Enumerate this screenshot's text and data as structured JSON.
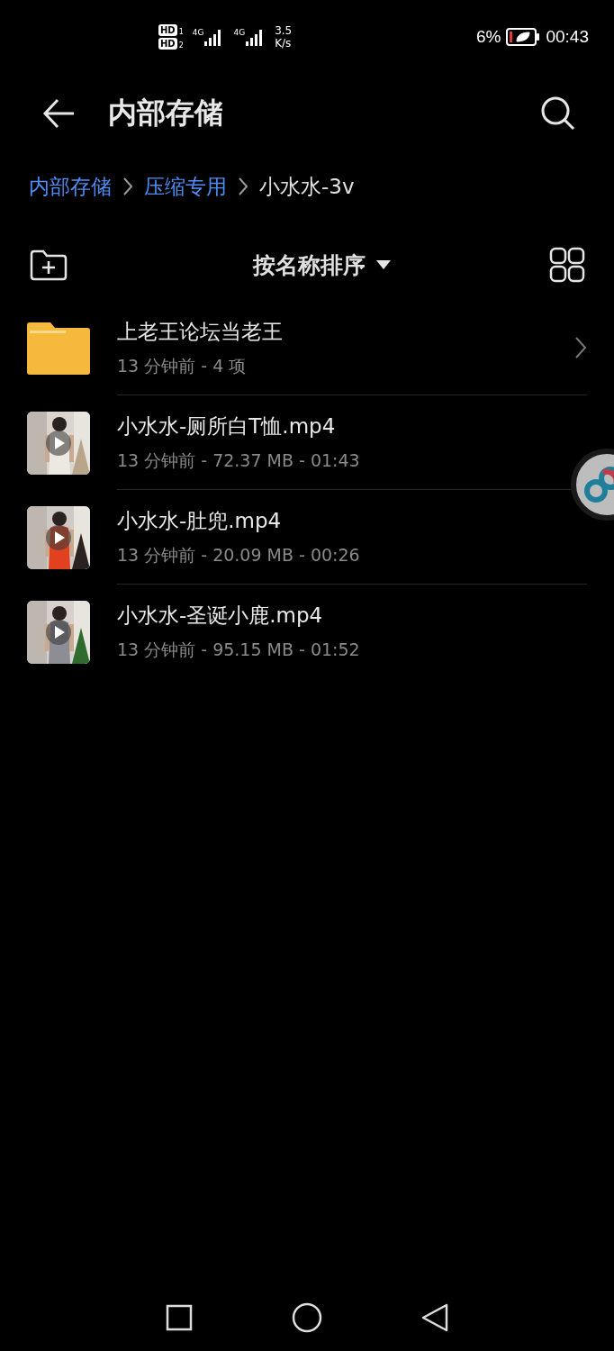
{
  "status_bar": {
    "sim_1": {
      "label": "HD",
      "slot": "1",
      "network": "4G"
    },
    "sim_2": {
      "label": "HD",
      "slot": "2",
      "network": "4G"
    },
    "speed_value": "3.5",
    "speed_unit": "K/s",
    "battery": "6%",
    "time": "00:43"
  },
  "header": {
    "title": "内部存储"
  },
  "breadcrumbs": [
    {
      "label": "内部存储",
      "selected": false
    },
    {
      "label": "压缩专用",
      "selected": false
    },
    {
      "label": "小水水-3v",
      "selected": true
    }
  ],
  "toolbar": {
    "sort": "按名称排序"
  },
  "files": [
    {
      "kind": "folder",
      "name": "上老王论坛当老王",
      "details": "13 分钟前 - 4 项"
    },
    {
      "kind": "video",
      "name": "小水水-厕所白T恤.mp4",
      "details": "13 分钟前 - 72.37 MB - 01:43"
    },
    {
      "kind": "video",
      "name": "小水水-肚兜.mp4",
      "details": "13 分钟前 - 20.09 MB - 00:26"
    },
    {
      "kind": "video",
      "name": "小水水-圣诞小鹿.mp4",
      "details": "13 分钟前 - 95.15 MB - 01:52"
    }
  ]
}
